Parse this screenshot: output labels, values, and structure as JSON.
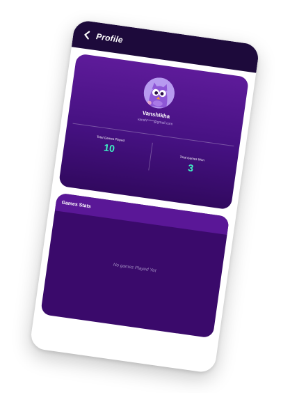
{
  "header": {
    "title": "Profile",
    "background": "#1d0a3b"
  },
  "profile": {
    "avatar_icon": "owl-avatar-icon",
    "name": "Vanshikha",
    "email": "vansh*****@gmail.com",
    "stats": {
      "played_label": "Total Games Played",
      "played_value": "10",
      "won_label": "Total Games Won",
      "won_value": "3"
    },
    "accent_color": "#3ff0c4",
    "card_color": "#4a1386"
  },
  "games_stats": {
    "title": "Games Stats",
    "empty_message": "No games Played Yet",
    "card_color": "#3a0a6b"
  }
}
